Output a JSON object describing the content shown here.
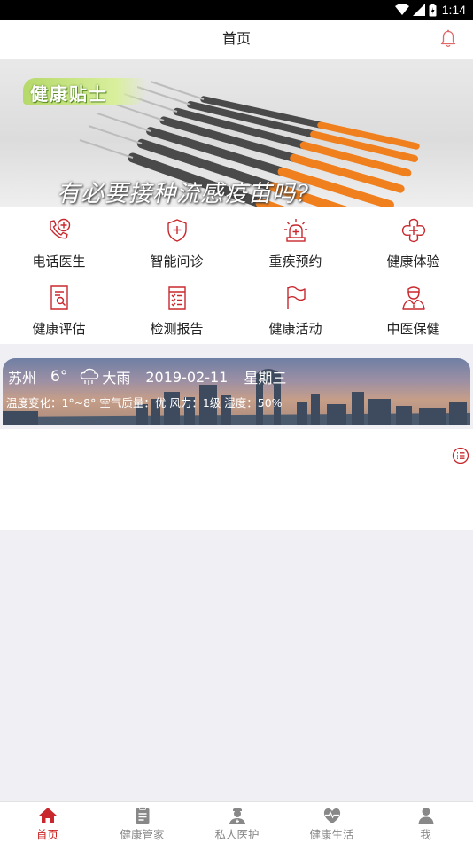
{
  "status_bar": {
    "time": "1:14"
  },
  "app_bar": {
    "title": "首页"
  },
  "banner": {
    "tag": "健康贴士",
    "headline": "有必要接种流感疫苗吗?",
    "slide_count": 3,
    "active_slide": 2
  },
  "services": [
    {
      "label": "电话医生",
      "icon": "phone-doctor-icon"
    },
    {
      "label": "智能问诊",
      "icon": "shield-plus-icon"
    },
    {
      "label": "重疾预约",
      "icon": "alarm-light-icon"
    },
    {
      "label": "健康体验",
      "icon": "cross-flower-icon"
    },
    {
      "label": "健康评估",
      "icon": "document-search-icon"
    },
    {
      "label": "检测报告",
      "icon": "checklist-icon"
    },
    {
      "label": "健康活动",
      "icon": "flag-icon"
    },
    {
      "label": "中医保健",
      "icon": "doctor-icon"
    }
  ],
  "weather": {
    "city": "苏州",
    "temp": "6°",
    "condition": "大雨",
    "date": "2019-02-11",
    "weekday": "星期三",
    "detail": "温度变化：1°~8° 空气质量：优 风力：1级 湿度：50%"
  },
  "tabs": [
    {
      "label": "首页",
      "icon": "home-icon",
      "active": true
    },
    {
      "label": "健康管家",
      "icon": "clipboard-icon",
      "active": false
    },
    {
      "label": "私人医护",
      "icon": "nurse-icon",
      "active": false
    },
    {
      "label": "健康生活",
      "icon": "heart-pulse-icon",
      "active": false
    },
    {
      "label": "我",
      "icon": "person-icon",
      "active": false
    }
  ],
  "colors": {
    "accent": "#c8282d",
    "tab_inactive": "#888888",
    "background": "#f0eff4"
  }
}
